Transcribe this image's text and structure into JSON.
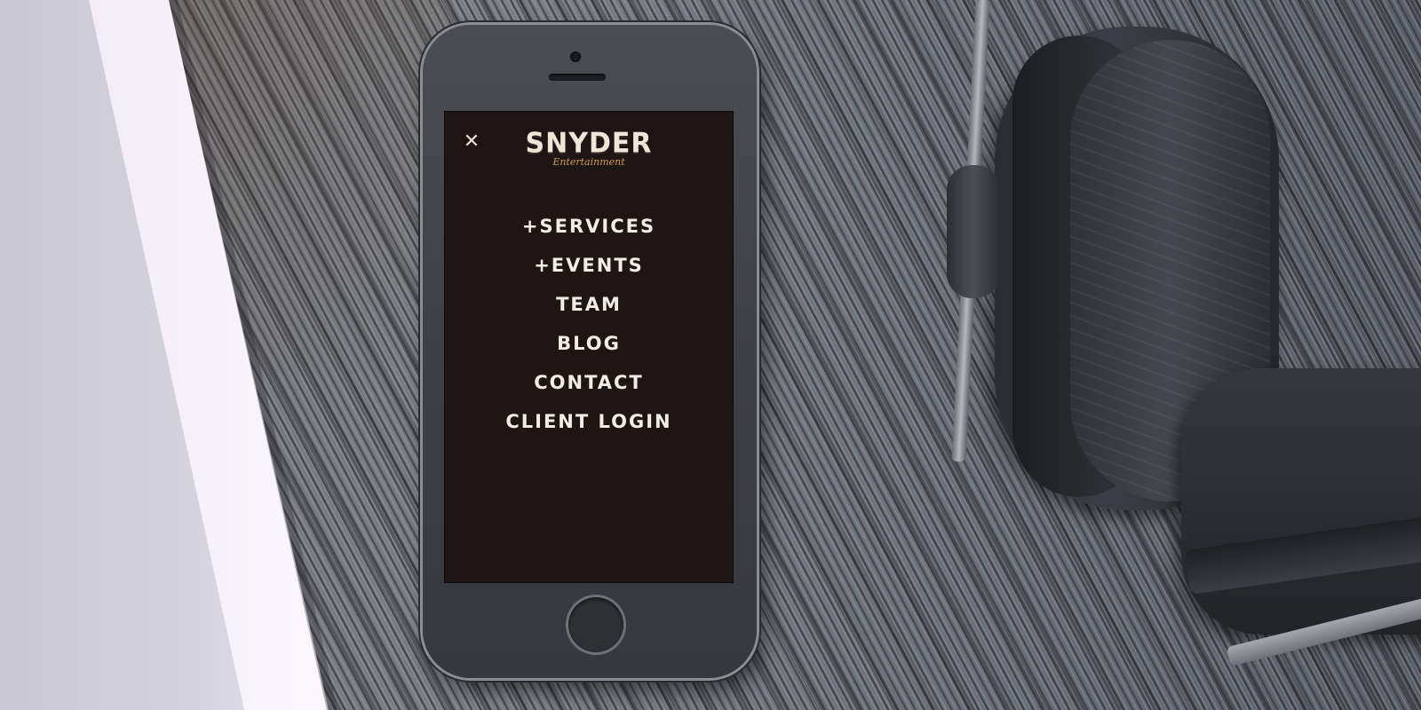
{
  "logo": {
    "name": "SNYDER",
    "tagline": "Entertainment",
    "accent_color": "#c89a4e"
  },
  "icons": {
    "close": "close-icon"
  },
  "menu": {
    "items": [
      {
        "label": "+SERVICES"
      },
      {
        "label": "+EVENTS"
      },
      {
        "label": "TEAM"
      },
      {
        "label": "BLOG"
      },
      {
        "label": "CONTACT"
      },
      {
        "label": "CLIENT LOGIN"
      }
    ]
  },
  "colors": {
    "screen_background": "#1e1614",
    "menu_text": "#f2ede4"
  }
}
